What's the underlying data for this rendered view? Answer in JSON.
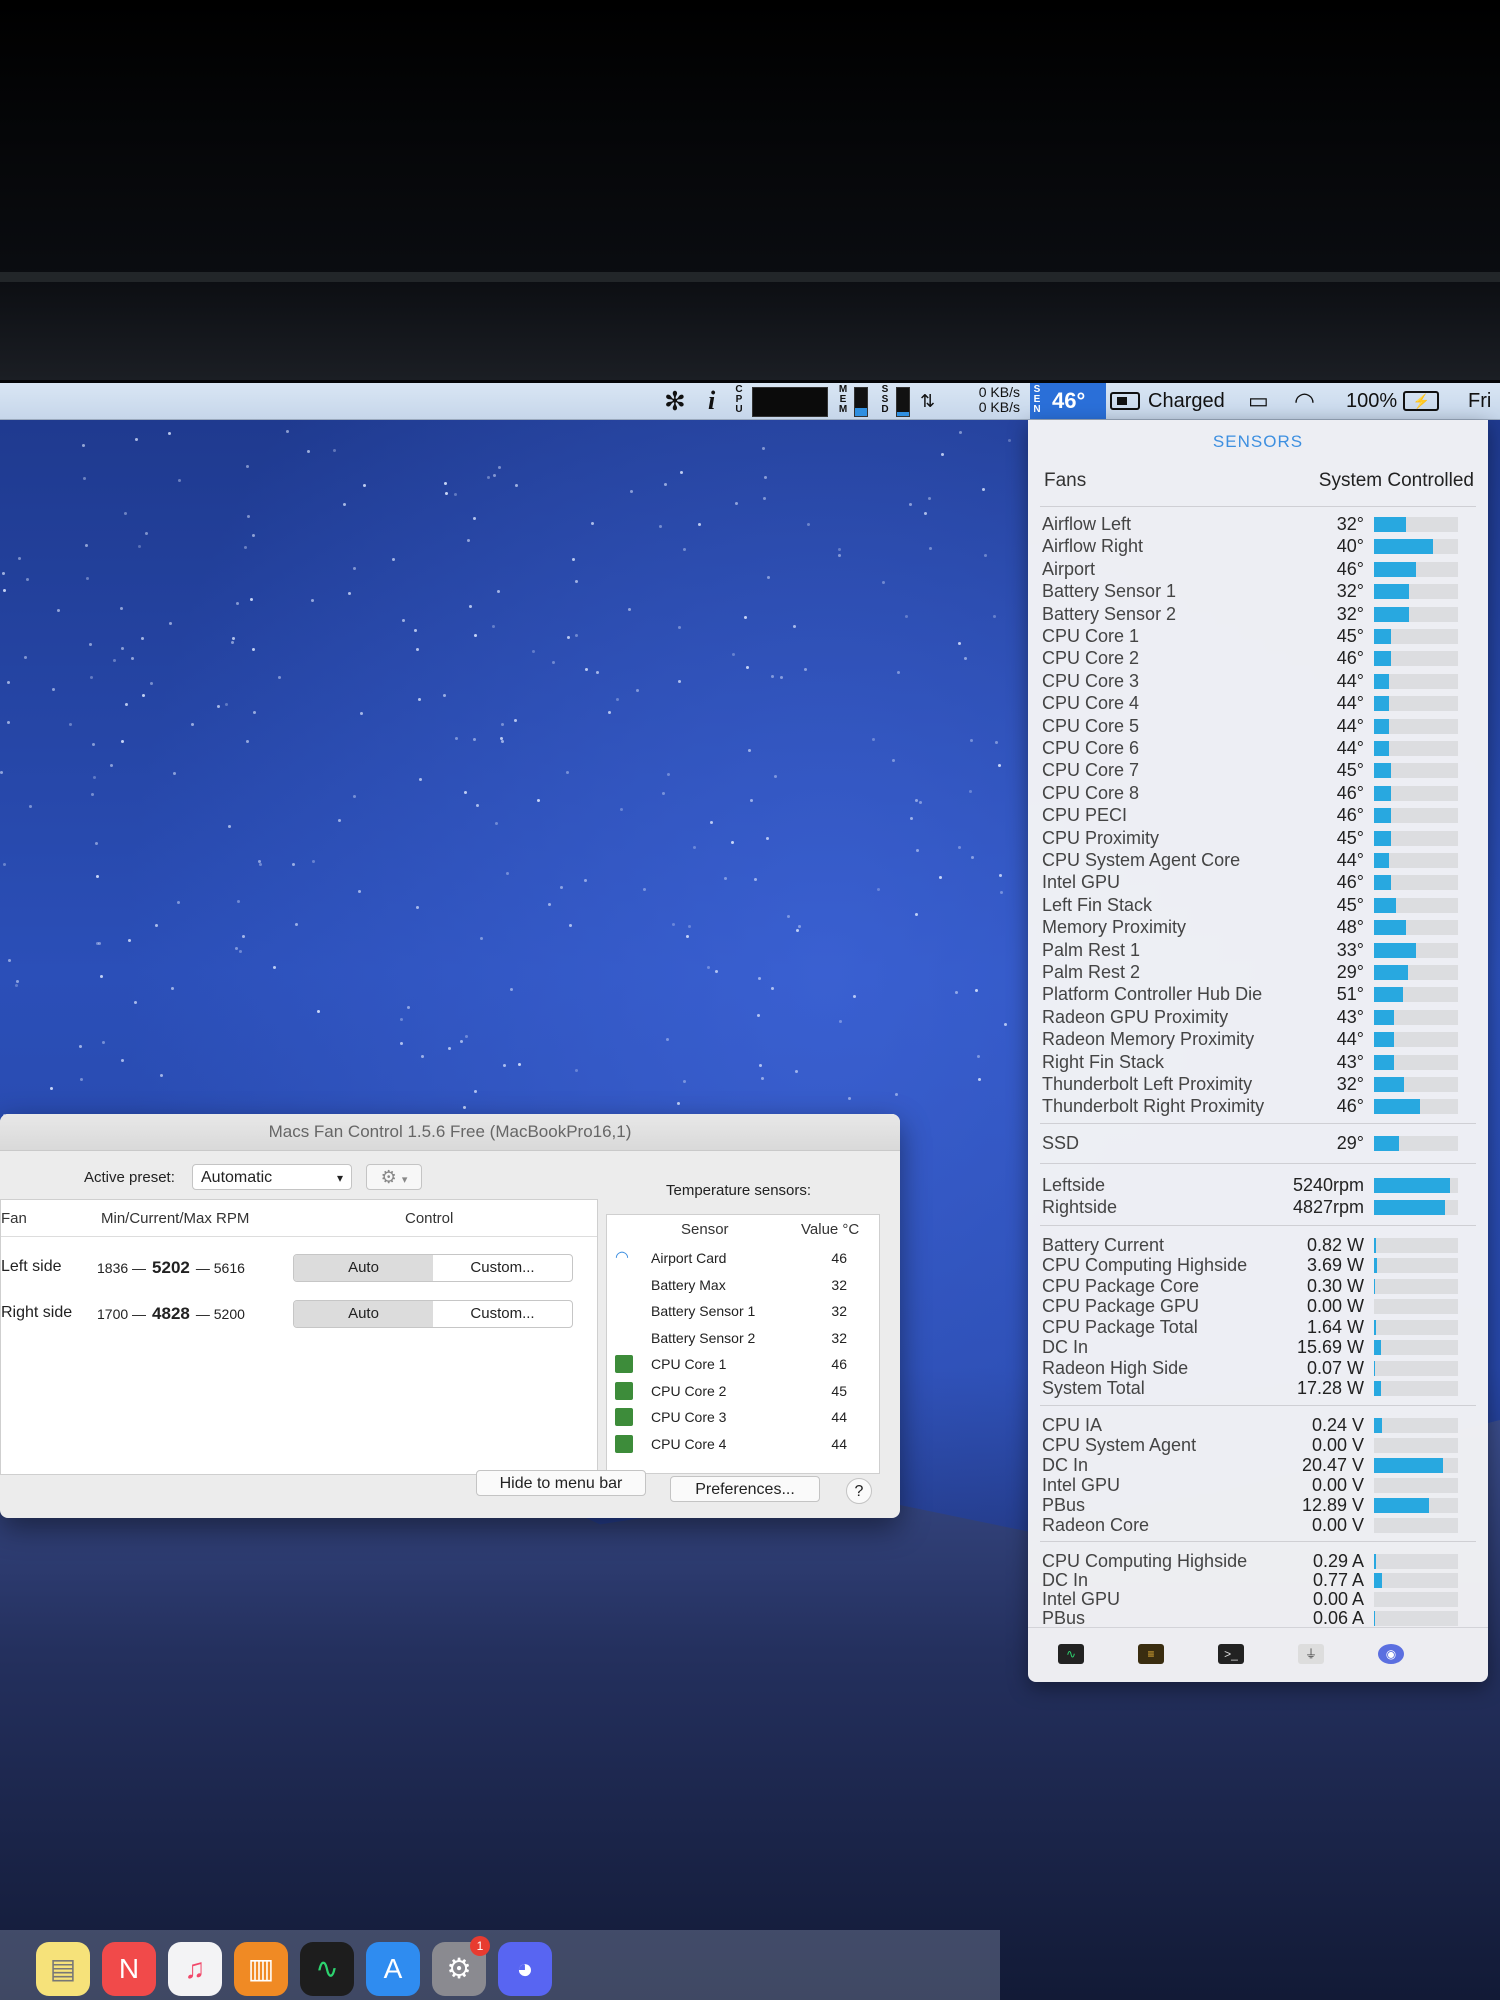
{
  "menubar": {
    "cpu_label": "CPU",
    "mem_label": "MEM",
    "ssd_label": "SSD",
    "net_up": "0 KB/s",
    "net_down": "0 KB/s",
    "sen_label": "SEN",
    "sen_temp": "46°",
    "battery_status": "Charged",
    "battery_percent": "100%",
    "day": "Fri",
    "icons": [
      "fan-icon",
      "info-icon",
      "cpu-graph",
      "memory-meter",
      "ssd-meter",
      "network-arrows-icon",
      "sensors-menu",
      "battery-icon",
      "airplay-icon",
      "wifi-icon",
      "battery-charging-icon"
    ]
  },
  "sensors_panel": {
    "title": "SENSORS",
    "fans_label": "Fans",
    "fans_value": "System Controlled",
    "temperatures": [
      {
        "name": "Airflow Left",
        "value": "32°",
        "level": 0.38
      },
      {
        "name": "Airflow Right",
        "value": "40°",
        "level": 0.7
      },
      {
        "name": "Airport",
        "value": "46°",
        "level": 0.5
      },
      {
        "name": "Battery Sensor 1",
        "value": "32°",
        "level": 0.42
      },
      {
        "name": "Battery Sensor 2",
        "value": "32°",
        "level": 0.42
      },
      {
        "name": "CPU Core 1",
        "value": "45°",
        "level": 0.2
      },
      {
        "name": "CPU Core 2",
        "value": "46°",
        "level": 0.2
      },
      {
        "name": "CPU Core 3",
        "value": "44°",
        "level": 0.18
      },
      {
        "name": "CPU Core 4",
        "value": "44°",
        "level": 0.18
      },
      {
        "name": "CPU Core 5",
        "value": "44°",
        "level": 0.18
      },
      {
        "name": "CPU Core 6",
        "value": "44°",
        "level": 0.18
      },
      {
        "name": "CPU Core 7",
        "value": "45°",
        "level": 0.2
      },
      {
        "name": "CPU Core 8",
        "value": "46°",
        "level": 0.2
      },
      {
        "name": "CPU PECI",
        "value": "46°",
        "level": 0.2
      },
      {
        "name": "CPU Proximity",
        "value": "45°",
        "level": 0.2
      },
      {
        "name": "CPU System Agent Core",
        "value": "44°",
        "level": 0.18
      },
      {
        "name": "Intel GPU",
        "value": "46°",
        "level": 0.2
      },
      {
        "name": "Left Fin Stack",
        "value": "45°",
        "level": 0.26
      },
      {
        "name": "Memory Proximity",
        "value": "48°",
        "level": 0.38
      },
      {
        "name": "Palm Rest 1",
        "value": "33°",
        "level": 0.5
      },
      {
        "name": "Palm Rest 2",
        "value": "29°",
        "level": 0.4
      },
      {
        "name": "Platform Controller Hub Die",
        "value": "51°",
        "level": 0.35
      },
      {
        "name": "Radeon GPU Proximity",
        "value": "43°",
        "level": 0.24
      },
      {
        "name": "Radeon Memory Proximity",
        "value": "44°",
        "level": 0.24
      },
      {
        "name": "Right Fin Stack",
        "value": "43°",
        "level": 0.24
      },
      {
        "name": "Thunderbolt Left Proximity",
        "value": "32°",
        "level": 0.36
      },
      {
        "name": "Thunderbolt Right Proximity",
        "value": "46°",
        "level": 0.55
      }
    ],
    "ssd_label": "SSD",
    "ssd_value": "29°",
    "ssd_level": 0.3,
    "fan_speeds": [
      {
        "name": "Leftside",
        "value": "5240rpm",
        "level": 0.9
      },
      {
        "name": "Rightside",
        "value": "4827rpm",
        "level": 0.85
      }
    ],
    "power": [
      {
        "name": "Battery Current",
        "value": "0.82 W",
        "level": 0.02
      },
      {
        "name": "CPU Computing Highside",
        "value": "3.69 W",
        "level": 0.03
      },
      {
        "name": "CPU Package Core",
        "value": "0.30 W",
        "level": 0.01
      },
      {
        "name": "CPU Package GPU",
        "value": "0.00 W",
        "level": 0.0
      },
      {
        "name": "CPU Package Total",
        "value": "1.64 W",
        "level": 0.02
      },
      {
        "name": "DC In",
        "value": "15.69 W",
        "level": 0.08
      },
      {
        "name": "Radeon High Side",
        "value": "0.07 W",
        "level": 0.01
      },
      {
        "name": "System Total",
        "value": "17.28 W",
        "level": 0.08
      }
    ],
    "voltage": [
      {
        "name": "CPU IA",
        "value": "0.24 V",
        "level": 0.1
      },
      {
        "name": "CPU System Agent",
        "value": "0.00 V",
        "level": 0.0
      },
      {
        "name": "DC In",
        "value": "20.47 V",
        "level": 0.82
      },
      {
        "name": "Intel GPU",
        "value": "0.00 V",
        "level": 0.0
      },
      {
        "name": "PBus",
        "value": "12.89 V",
        "level": 0.65
      },
      {
        "name": "Radeon Core",
        "value": "0.00 V",
        "level": 0.0
      }
    ],
    "current": [
      {
        "name": "CPU Computing Highside",
        "value": "0.29 A",
        "level": 0.02
      },
      {
        "name": "DC In",
        "value": "0.77 A",
        "level": 0.1
      },
      {
        "name": "Intel GPU",
        "value": "0.00 A",
        "level": 0.0
      },
      {
        "name": "PBus",
        "value": "0.06 A",
        "level": 0.01
      }
    ],
    "footer_icons": [
      "activity-monitor-icon",
      "console-icon",
      "terminal-icon",
      "power-adapter-icon",
      "color-picker-icon"
    ]
  },
  "mfc_window": {
    "title": "Macs Fan Control 1.5.6 Free (MacBookPro16,1)",
    "preset_label": "Active preset:",
    "preset_value": "Automatic",
    "col_fan": "Fan",
    "col_rpm": "Min/Current/Max RPM",
    "col_control": "Control",
    "fans": [
      {
        "name": "Left side",
        "min": "1836",
        "current": "5202",
        "max": "5616",
        "auto": "Auto",
        "custom": "Custom..."
      },
      {
        "name": "Right side",
        "min": "1700",
        "current": "4828",
        "max": "5200",
        "auto": "Auto",
        "custom": "Custom..."
      }
    ],
    "dash": "—",
    "temp_title": "Temperature sensors:",
    "col_sensor": "Sensor",
    "col_value": "Value °C",
    "sensors": [
      {
        "name": "Airport Card",
        "value": "46",
        "icon": "wifi"
      },
      {
        "name": "Battery Max",
        "value": "32",
        "icon": "none"
      },
      {
        "name": "Battery Sensor 1",
        "value": "32",
        "icon": "none"
      },
      {
        "name": "Battery Sensor 2",
        "value": "32",
        "icon": "none"
      },
      {
        "name": "CPU Core 1",
        "value": "46",
        "icon": "chip"
      },
      {
        "name": "CPU Core 2",
        "value": "45",
        "icon": "chip"
      },
      {
        "name": "CPU Core 3",
        "value": "44",
        "icon": "chip"
      },
      {
        "name": "CPU Core 4",
        "value": "44",
        "icon": "chip"
      }
    ],
    "hide_button": "Hide to menu bar",
    "prefs_button": "Preferences...",
    "help_button": "?"
  },
  "dock": {
    "apps": [
      "notes-icon",
      "news-icon",
      "music-icon",
      "books-icon",
      "activity-monitor-icon",
      "app-store-icon",
      "system-preferences-icon",
      "discord-icon"
    ],
    "badge": "1"
  }
}
